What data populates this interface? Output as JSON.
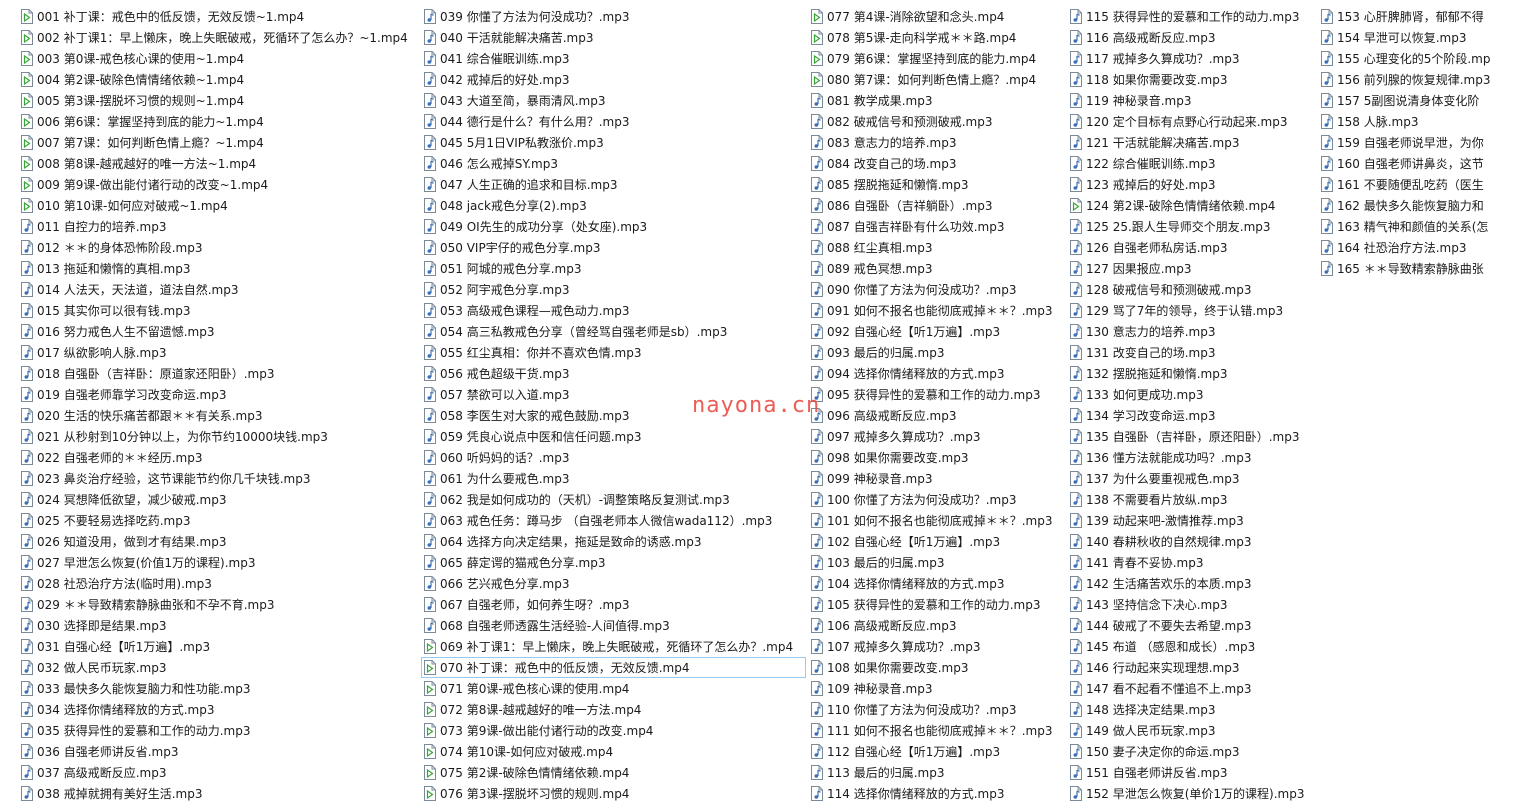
{
  "watermark": "nayona.cn",
  "focused_index": 69,
  "icons": {
    "mp4": "video-file-icon",
    "mp3": "audio-file-icon"
  },
  "colors": {
    "video_icon": "#3aa63a",
    "audio_icon": "#3b6fb6",
    "selection_border": "#99c9ef",
    "watermark": "#e8433a"
  },
  "files": [
    "001 补丁课：戒色中的低反馈，无效反馈~1.mp4",
    "002 补丁课1：早上懒床，晚上失眠破戒，死循环了怎么办？~1.mp4",
    "003 第0课-戒色核心课的使用~1.mp4",
    "004 第2课-破除色情情绪依赖~1.mp4",
    "005 第3课-摆脱坏习惯的规则~1.mp4",
    "006 第6课：掌握坚持到底的能力~1.mp4",
    "007 第7课：如何判断色情上瘾？~1.mp4",
    "008 第8课-越戒越好的唯一方法~1.mp4",
    "009 第9课-做出能付诸行动的改变~1.mp4",
    "010 第10课-如何应对破戒~1.mp4",
    "011 自控力的培养.mp3",
    "012 ＊＊的身体恐怖阶段.mp3",
    "013 拖延和懒惰的真相.mp3",
    "014 人法天，天法道，道法自然.mp3",
    "015 其实你可以很有钱.mp3",
    "016 努力戒色人生不留遗憾.mp3",
    "017 纵欲影响人脉.mp3",
    "018 自强卧（吉祥卧：原道家还阳卧）.mp3",
    "019 自强老师靠学习改变命运.mp3",
    "020 生活的快乐痛苦都跟＊＊有关系.mp3",
    "021 从秒射到10分钟以上，为你节约10000块钱.mp3",
    "022 自强老师的＊＊经历.mp3",
    "023 鼻炎治疗经验，这节课能节约你几千块钱.mp3",
    "024 冥想降低欲望，减少破戒.mp3",
    "025 不要轻易选择吃药.mp3",
    "026 知道没用，做到才有结果.mp3",
    "027 早泄怎么恢复(价值1万的课程).mp3",
    "028 社恐治疗方法(临时用).mp3",
    "029 ＊＊导致精索静脉曲张和不孕不育.mp3",
    "030 选择即是结果.mp3",
    "031 自强心经【听1万遍】.mp3",
    "032 做人民币玩家.mp3",
    "033 最快多久能恢复脑力和性功能.mp3",
    "034 选择你情绪释放的方式.mp3",
    "035 获得异性的爱慕和工作的动力.mp3",
    "036 自强老师讲反省.mp3",
    "037 高级戒断反应.mp3",
    "038 戒掉就拥有美好生活.mp3",
    "039 你懂了方法为何没成功？.mp3",
    "040 干活就能解决痛苦.mp3",
    "041 综合催眠训练.mp3",
    "042 戒掉后的好处.mp3",
    "043 大道至简，暴雨清风.mp3",
    "044 德行是什么？有什么用？.mp3",
    "045 5月1日VIP私教涨价.mp3",
    "046 怎么戒掉SY.mp3",
    "047 人生正确的追求和目标.mp3",
    "048 jack戒色分享(2).mp3",
    "049 OI先生的成功分享（处女座).mp3",
    "050 VIP宇仔的戒色分享.mp3",
    "051 阿城的戒色分享.mp3",
    "052 阿宇戒色分享.mp3",
    "053 高级戒色课程—戒色动力.mp3",
    "054 高三私教戒色分享（曾经骂自强老师是sb）.mp3",
    "055 红尘真相：你并不喜欢色情.mp3",
    "056 戒色超级干货.mp3",
    "057 禁欲可以入道.mp3",
    "058 李医生对大家的戒色鼓励.mp3",
    "059 凭良心说点中医和信任问题.mp3",
    "060 听妈妈的话？.mp3",
    "061 为什么要戒色.mp3",
    "062 我是如何成功的（天机）-调整策略反复测试.mp3",
    "063 戒色任务：蹲马步 （自强老师本人微信wada112）.mp3",
    "064 选择方向决定结果，拖延是致命的诱惑.mp3",
    "065 薛定谔的猫戒色分享.mp3",
    "066 艺兴戒色分享.mp3",
    "067 自强老师，如何养生呀？.mp3",
    "068 自强老师透露生活经验-人间值得.mp3",
    "069 补丁课1：早上懒床，晚上失眠破戒，死循环了怎么办？.mp4",
    "070 补丁课：戒色中的低反馈，无效反馈.mp4",
    "071 第0课-戒色核心课的使用.mp4",
    "072 第8课-越戒越好的唯一方法.mp4",
    "073 第9课-做出能付诸行动的改变.mp4",
    "074 第10课-如何应对破戒.mp4",
    "075 第2课-破除色情情绪依赖.mp4",
    "076 第3课-摆脱坏习惯的规则.mp4",
    "077 第4课-消除欲望和念头.mp4",
    "078 第5课-走向科学戒＊＊路.mp4",
    "079 第6课：掌握坚持到底的能力.mp4",
    "080 第7课：如何判断色情上瘾？.mp4",
    "081 教学成果.mp3",
    "082 破戒信号和预测破戒.mp3",
    "083 意志力的培养.mp3",
    "084 改变自己的场.mp3",
    "085 摆脱拖延和懒惰.mp3",
    "086 自强卧（吉祥躺卧）.mp3",
    "087 自强吉祥卧有什么功效.mp3",
    "088 红尘真相.mp3",
    "089 戒色冥想.mp3",
    "090 你懂了方法为何没成功？.mp3",
    "091 如何不报名也能彻底戒掉＊＊？.mp3",
    "092 自强心经【听1万遍】.mp3",
    "093 最后的归属.mp3",
    "094 选择你情绪释放的方式.mp3",
    "095 获得异性的爱慕和工作的动力.mp3",
    "096 高级戒断反应.mp3",
    "097 戒掉多久算成功？.mp3",
    "098 如果你需要改变.mp3",
    "099 神秘录音.mp3",
    "100 你懂了方法为何没成功？.mp3",
    "101 如何不报名也能彻底戒掉＊＊？.mp3",
    "102 自强心经【听1万遍】.mp3",
    "103 最后的归属.mp3",
    "104 选择你情绪释放的方式.mp3",
    "105 获得异性的爱慕和工作的动力.mp3",
    "106 高级戒断反应.mp3",
    "107 戒掉多久算成功？.mp3",
    "108 如果你需要改变.mp3",
    "109 神秘录音.mp3",
    "110 你懂了方法为何没成功？.mp3",
    "111 如何不报名也能彻底戒掉＊＊？.mp3",
    "112 自强心经【听1万遍】.mp3",
    "113 最后的归属.mp3",
    "114 选择你情绪释放的方式.mp3",
    "115 获得异性的爱慕和工作的动力.mp3",
    "116 高级戒断反应.mp3",
    "117 戒掉多久算成功？.mp3",
    "118 如果你需要改变.mp3",
    "119 神秘录音.mp3",
    "120 定个目标有点野心行动起来.mp3",
    "121 干活就能解决痛苦.mp3",
    "122 综合催眠训练.mp3",
    "123 戒掉后的好处.mp3",
    "124 第2课-破除色情情绪依赖.mp4",
    "125 25.跟人生导师交个朋友.mp3",
    "126 自强老师私房话.mp3",
    "127 因果报应.mp3",
    "128 破戒信号和预测破戒.mp3",
    "129 骂了7年的领导，终于认错.mp3",
    "130 意志力的培养.mp3",
    "131 改变自己的场.mp3",
    "132 摆脱拖延和懒惰.mp3",
    "133 如何更成功.mp3",
    "134 学习改变命运.mp3",
    "135 自强卧（吉祥卧，原还阳卧）.mp3",
    "136 懂方法就能成功吗？.mp3",
    "137 为什么要重视戒色.mp3",
    "138 不需要看片放纵.mp3",
    "139 动起来吧-激情推荐.mp3",
    "140 春耕秋收的自然规律.mp3",
    "141 青春不妥协.mp3",
    "142 生活痛苦欢乐的本质.mp3",
    "143 坚持信念下决心.mp3",
    "144 破戒了不要失去希望.mp3",
    "145 布道 （感恩和成长）.mp3",
    "146 行动起来实现理想.mp3",
    "147 看不起看不懂追不上.mp3",
    "148 选择决定结果.mp3",
    "149 做人民币玩家.mp3",
    "150 妻子决定你的命运.mp3",
    "151 自强老师讲反省.mp3",
    "152 早泄怎么恢复(单价1万的课程).mp3",
    "153 心肝脾肺肾，郁郁不得",
    "154 早泄可以恢复.mp3",
    "155 心理变化的5个阶段.mp",
    "156 前列腺的恢复规律.mp3",
    "157 5副图说清身体变化阶",
    "158 人脉.mp3",
    "159 自强老师说早泄，为你",
    "160 自强老师讲鼻炎，这节",
    "161 不要随便乱吃药（医生",
    "162 最快多久能恢复脑力和",
    "163 精气神和颜值的关系(怎",
    "164 社恐治疗方法.mp3",
    "165 ＊＊导致精索静脉曲张"
  ]
}
